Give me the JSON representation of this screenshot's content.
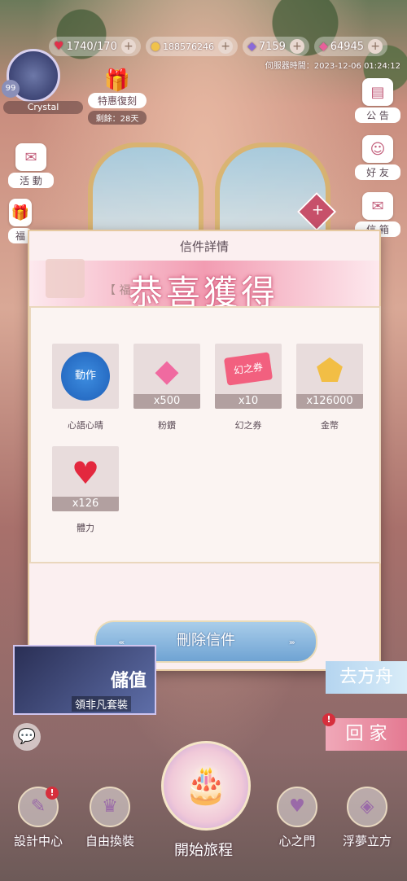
{
  "resources": {
    "stamina": {
      "icon": "heart-icon",
      "value": "1740/170"
    },
    "gold": {
      "icon": "cat-coin-icon",
      "value": "188576246"
    },
    "diamonds": {
      "icon": "purple-diamond-icon",
      "value": "7159"
    },
    "pink_diamonds": {
      "icon": "pink-diamond-icon",
      "value": "64945"
    }
  },
  "server_time": "伺服器時間：2023-12-06 01:24:12",
  "player": {
    "level": "99",
    "name": "Crystal"
  },
  "special_offer": {
    "label": "特惠復刻",
    "remaining": "剩餘：28天"
  },
  "left_menu": [
    {
      "label": "活 動"
    },
    {
      "label": "福"
    }
  ],
  "right_menu": [
    {
      "label": "公 告"
    },
    {
      "label": "好 友"
    },
    {
      "label": "信 箱"
    }
  ],
  "mail": {
    "window_title": "信件詳情",
    "subject": "【 福",
    "congrats": "恭喜獲得",
    "rewards": [
      {
        "name": "心語心晴",
        "quantity": "",
        "icon": "action-icon",
        "art_text": "動作"
      },
      {
        "name": "粉鑽",
        "quantity": "x500",
        "icon": "pink-diamond-icon",
        "art_text": ""
      },
      {
        "name": "幻之券",
        "quantity": "x10",
        "icon": "ticket-icon",
        "art_text": "幻之券"
      },
      {
        "name": "金幣",
        "quantity": "x126000",
        "icon": "gold-coin-icon",
        "art_text": ""
      },
      {
        "name": "體力",
        "quantity": "x126",
        "icon": "heart-icon",
        "art_text": ""
      }
    ],
    "delete_button": "刪除信件"
  },
  "promo": {
    "title": "儲值",
    "subtitle": "領非凡套裝"
  },
  "right_banners": {
    "go_cube": "去方舟",
    "go_home": "回 家"
  },
  "bottom_nav": [
    {
      "label": "設計中心",
      "icon": "design-icon"
    },
    {
      "label": "自由換裝",
      "icon": "dress-icon"
    },
    {
      "label": "開始旅程",
      "icon": "cake-icon"
    },
    {
      "label": "心之門",
      "icon": "heart-gate-icon"
    },
    {
      "label": "浮夢立方",
      "icon": "cube-icon"
    }
  ]
}
